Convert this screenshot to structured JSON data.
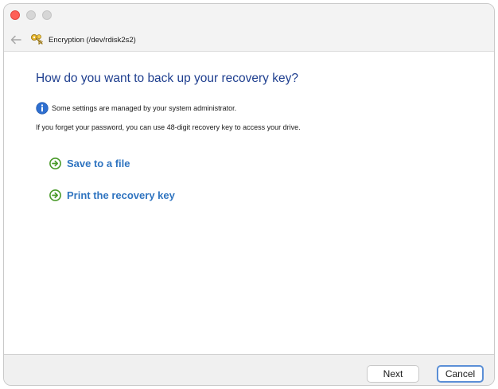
{
  "window": {
    "colors": {
      "close": "#fe5f57",
      "inactive": "#d6d6d6"
    }
  },
  "nav": {
    "back_icon": "back-arrow-icon",
    "app_icon": "keys-icon",
    "title": "Encryption (/dev/rdisk2s2)"
  },
  "main": {
    "heading": "How do you want to back up your recovery key?",
    "info_icon": "info-icon",
    "info_text": "Some settings are managed by your system administrator.",
    "description": "If you forget your password, you can use 48-digit recovery key to access your drive.",
    "options": [
      {
        "label": "Save to a file",
        "icon": "green-arrow-icon"
      },
      {
        "label": "Print the recovery key",
        "icon": "green-arrow-icon"
      }
    ],
    "colors": {
      "heading": "#1f3f8f",
      "link": "#2f74c0",
      "option_icon": "#4a9a2a"
    }
  },
  "footer": {
    "next_label": "Next",
    "cancel_label": "Cancel",
    "focus_color": "#5b8fd6"
  }
}
